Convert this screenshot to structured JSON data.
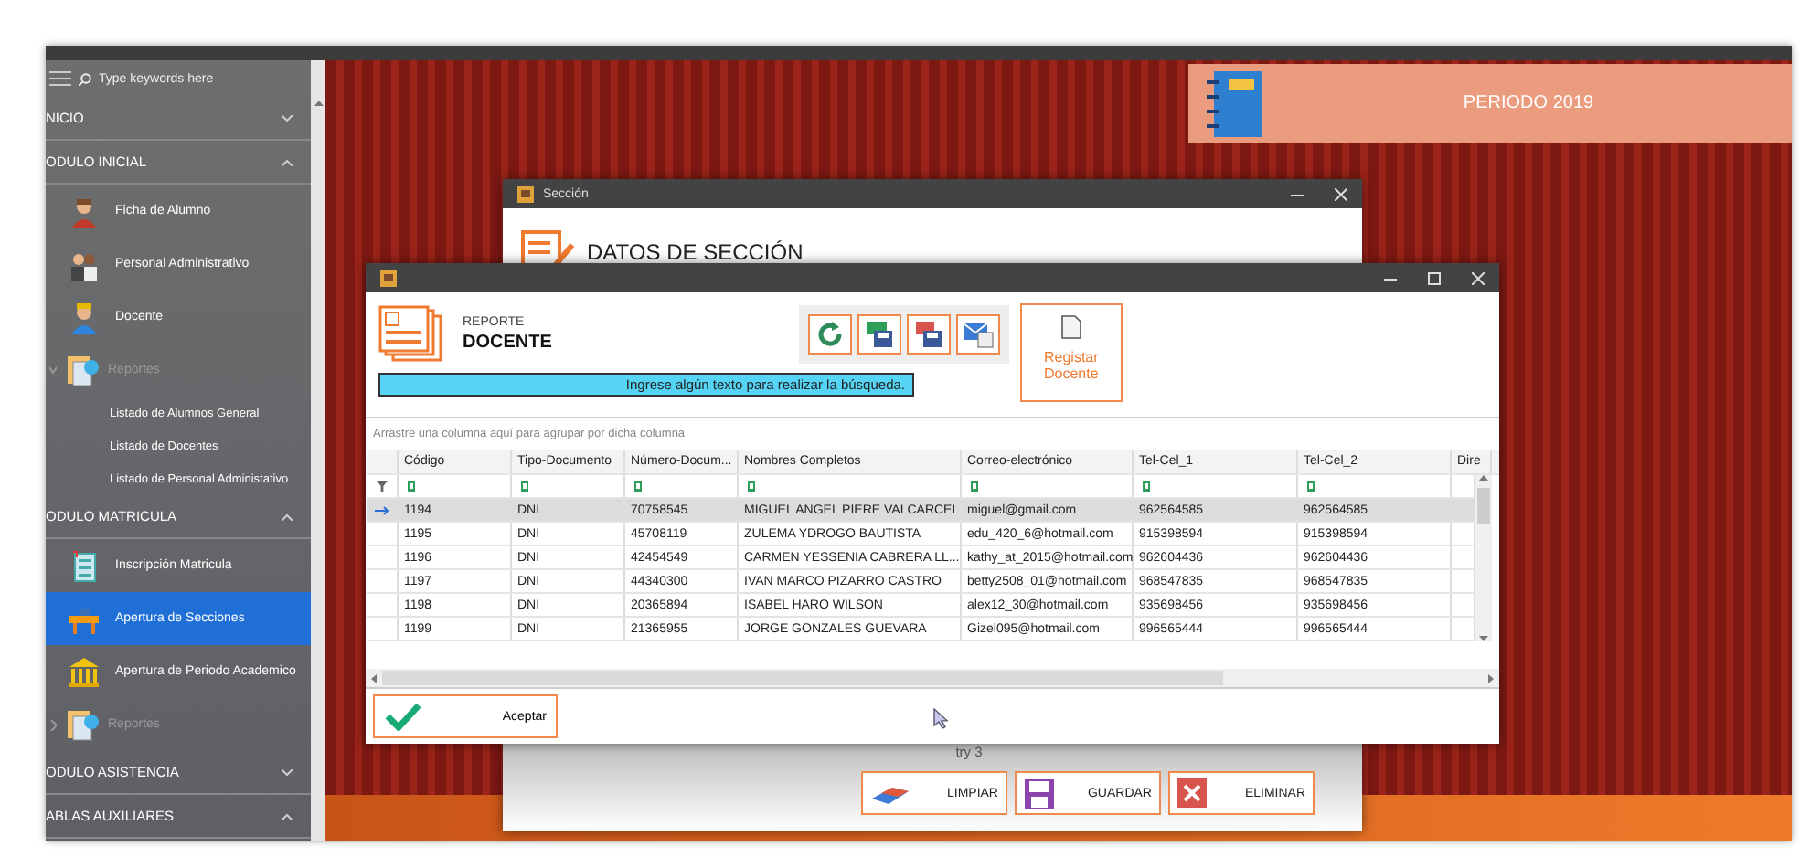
{
  "sidebar": {
    "search_placeholder": "Type keywords here",
    "sections": [
      {
        "title": "NICIO",
        "expanded": false
      },
      {
        "title": "ODULO INICIAL",
        "expanded": true,
        "items": [
          {
            "kind": "item",
            "label": "Ficha de Alumno",
            "selected": false
          },
          {
            "kind": "item",
            "label": "Personal Administrativo",
            "selected": false
          },
          {
            "kind": "item",
            "label": "Docente",
            "selected": false
          },
          {
            "kind": "group",
            "label": "Reportes",
            "expanded": true
          },
          {
            "kind": "subitem",
            "label": "Listado de Alumnos General",
            "selected": false
          },
          {
            "kind": "subitem",
            "label": "Listado de Docentes",
            "selected": false
          },
          {
            "kind": "subitem",
            "label": "Listado de Personal Administativo",
            "selected": false
          }
        ]
      },
      {
        "title": "ODULO MATRICULA",
        "expanded": true,
        "items": [
          {
            "kind": "item",
            "label": "Inscripción Matricula",
            "selected": false
          },
          {
            "kind": "item",
            "label": "Apertura de Secciones",
            "selected": true
          },
          {
            "kind": "item",
            "label": "Apertura de Periodo Academico",
            "selected": false
          },
          {
            "kind": "group",
            "label": "Reportes",
            "expanded": false
          }
        ]
      },
      {
        "title": "ODULO ASISTENCIA",
        "expanded": false
      },
      {
        "title": "ABLAS AUXILIARES",
        "expanded": true
      }
    ]
  },
  "periodo_banner": {
    "text": "PERIODO 2019"
  },
  "seccion_window": {
    "title": "Sección",
    "heading": "DATOS DE SECCIÓN",
    "status_text": "try 3",
    "buttons": [
      {
        "kind": "clear",
        "label": "LIMPIAR"
      },
      {
        "kind": "save",
        "label": "GUARDAR"
      },
      {
        "kind": "delete",
        "label": "ELIMINAR"
      }
    ]
  },
  "report_window": {
    "subtitle": "REPORTE",
    "title": "DOCENTE",
    "toolbar": [
      {
        "kind": "refresh"
      },
      {
        "kind": "excel"
      },
      {
        "kind": "pdf"
      },
      {
        "kind": "email"
      }
    ],
    "search": {
      "placeholder": "Ingrese algún texto para realizar la búsqueda."
    },
    "register_button": "Registar Docente",
    "group_hint": "Arrastre una columna aquí para agrupar por dicha columna",
    "table": {
      "columns": [
        "Código",
        "Tipo-Documento",
        "Número-Docum...",
        "Nombres Completos",
        "Correo-electrónico",
        "Tel-Cel_1",
        "Tel-Cel_2",
        "Dire"
      ],
      "rows": [
        {
          "selected": true,
          "cells": [
            "1194",
            "DNI",
            "70758545",
            "MIGUEL ANGEL PIERE VALCARCEL",
            "miguel@gmail.com",
            "962564585",
            "962564585"
          ]
        },
        {
          "selected": false,
          "cells": [
            "1195",
            "DNI",
            "45708119",
            "ZULEMA YDROGO BAUTISTA",
            "edu_420_6@hotmail.com",
            "915398594",
            "915398594"
          ]
        },
        {
          "selected": false,
          "cells": [
            "1196",
            "DNI",
            "42454549",
            "CARMEN YESSENIA CABRERA LL...",
            "kathy_at_2015@hotmail.com",
            "962604436",
            "962604436"
          ]
        },
        {
          "selected": false,
          "cells": [
            "1197",
            "DNI",
            "44340300",
            "IVAN MARCO PIZARRO CASTRO",
            "betty2508_01@hotmail.com",
            "968547835",
            "968547835"
          ]
        },
        {
          "selected": false,
          "cells": [
            "1198",
            "DNI",
            "20365894",
            "ISABEL HARO WILSON",
            "alex12_30@hotmail.com",
            "935698456",
            "935698456"
          ]
        },
        {
          "selected": false,
          "cells": [
            "1199",
            "DNI",
            "21365955",
            "JORGE GONZALES GUEVARA",
            "Gizel095@hotmail.com",
            "996565444",
            "996565444"
          ]
        }
      ]
    },
    "accept_button": "Aceptar"
  }
}
